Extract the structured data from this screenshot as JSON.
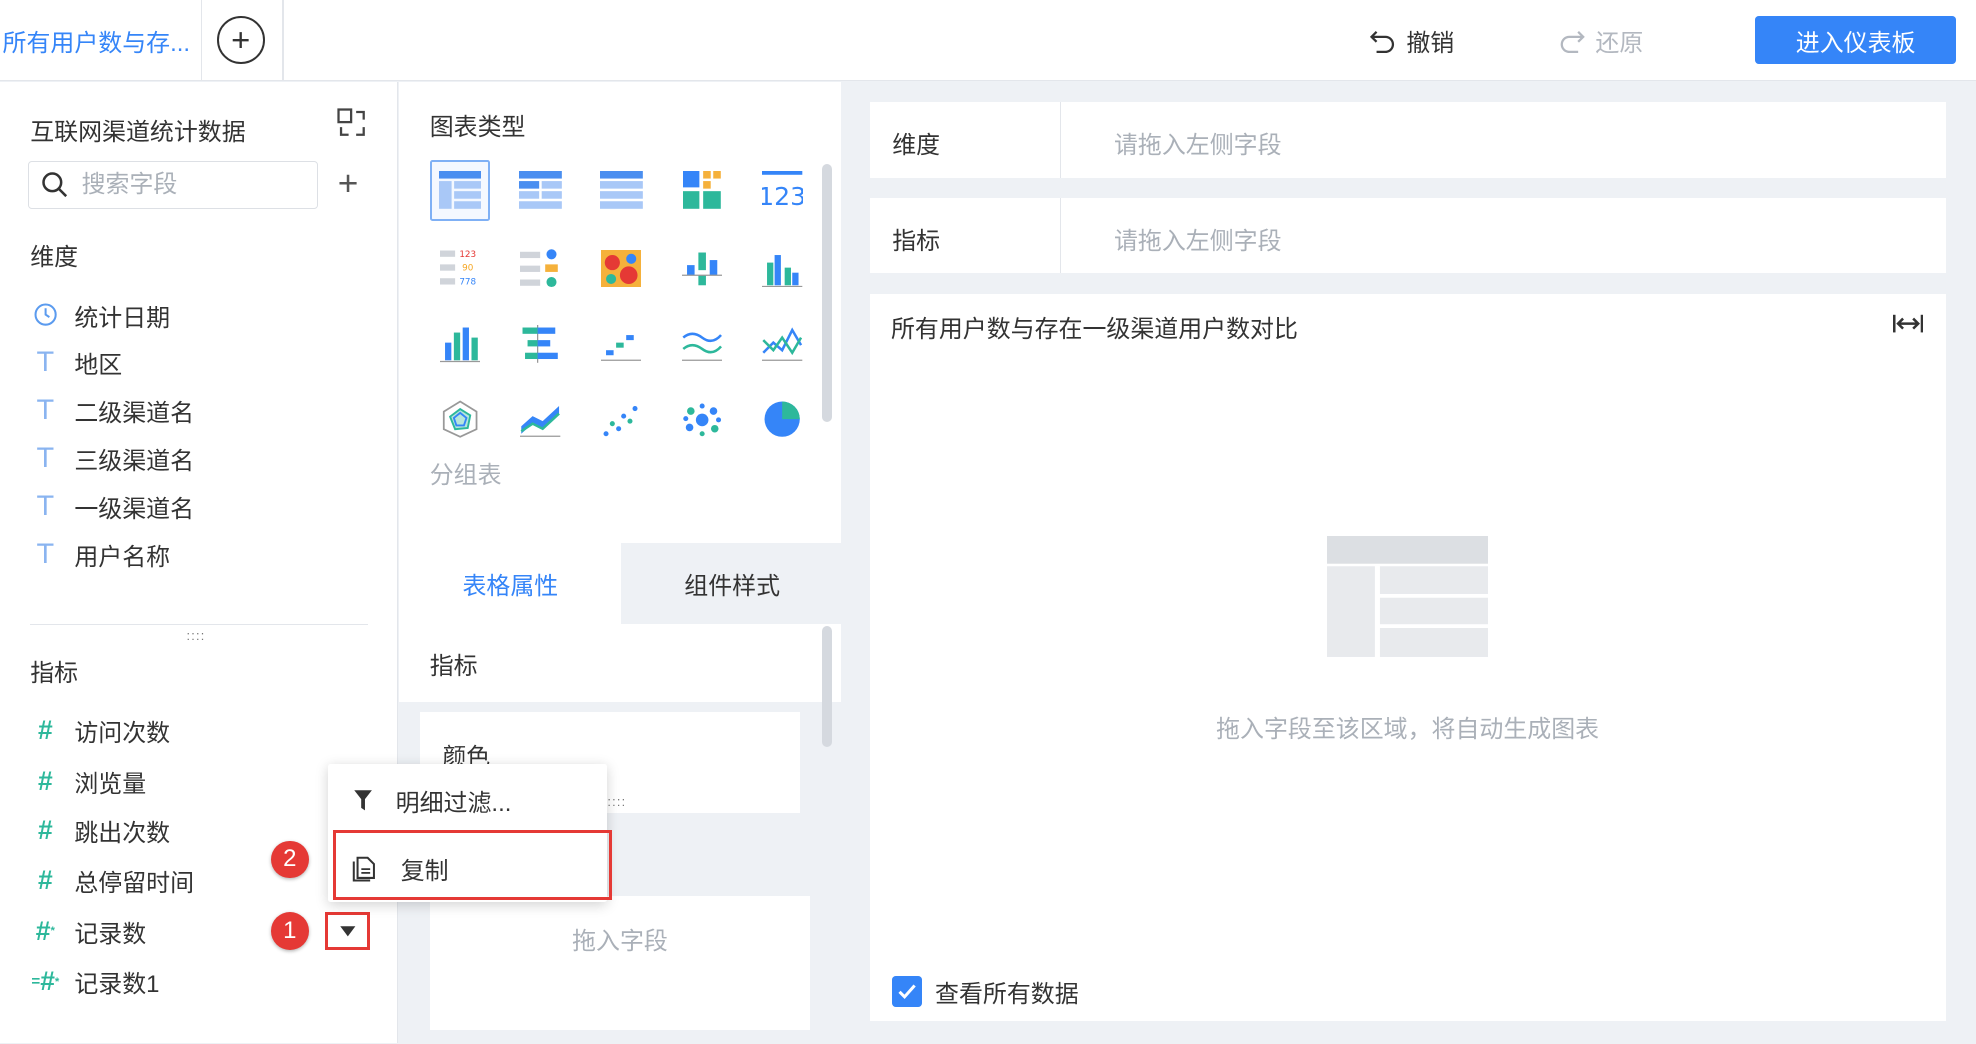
{
  "topbar": {
    "active_tab": "所有用户数与存...",
    "undo": "撤销",
    "redo": "还原",
    "enter_dashboard": "进入仪表板"
  },
  "left": {
    "dataset_title": "互联网渠道统计数据",
    "search_placeholder": "搜索字段",
    "dimension_label": "维度",
    "dimensions": [
      {
        "icon": "clock-icon",
        "label": "统计日期"
      },
      {
        "icon": "text-type-icon",
        "label": "地区"
      },
      {
        "icon": "text-type-icon",
        "label": "二级渠道名"
      },
      {
        "icon": "text-type-icon",
        "label": "三级渠道名"
      },
      {
        "icon": "text-type-icon",
        "label": "一级渠道名"
      },
      {
        "icon": "text-type-icon",
        "label": "用户名称"
      }
    ],
    "metric_label": "指标",
    "metrics": [
      {
        "icon": "number-type-icon",
        "label": "访问次数"
      },
      {
        "icon": "number-type-icon",
        "label": "浏览量"
      },
      {
        "icon": "number-type-icon",
        "label": "跳出次数"
      },
      {
        "icon": "number-type-icon",
        "label": "总停留时间"
      },
      {
        "icon": "record-count-icon",
        "label": "记录数"
      },
      {
        "icon": "copied-record-count-icon",
        "label": "记录数1"
      }
    ],
    "badge_1": "1",
    "badge_2": "2"
  },
  "context_menu": {
    "items": [
      {
        "icon": "filter-icon",
        "label": "明细过滤..."
      },
      {
        "icon": "copy-icon",
        "label": "复制"
      }
    ]
  },
  "middle": {
    "chart_type_title": "图表类型",
    "selected_chart_label": "分组表",
    "tabs": [
      "表格属性",
      "组件样式"
    ],
    "metric_label": "指标",
    "color_label": "颜色",
    "drag_placeholder": "拖入字段"
  },
  "right": {
    "dimension_label": "维度",
    "dimension_placeholder": "请拖入左侧字段",
    "metric_label": "指标",
    "metric_placeholder": "请拖入左侧字段",
    "component_title": "所有用户数与存在一级渠道用户数对比",
    "empty_hint": "拖入字段至该区域，将自动生成图表",
    "view_all": "查看所有数据"
  },
  "colors": {
    "accent": "#3585f8",
    "highlight": "#e53935",
    "metric_icon": "#2db89b"
  }
}
